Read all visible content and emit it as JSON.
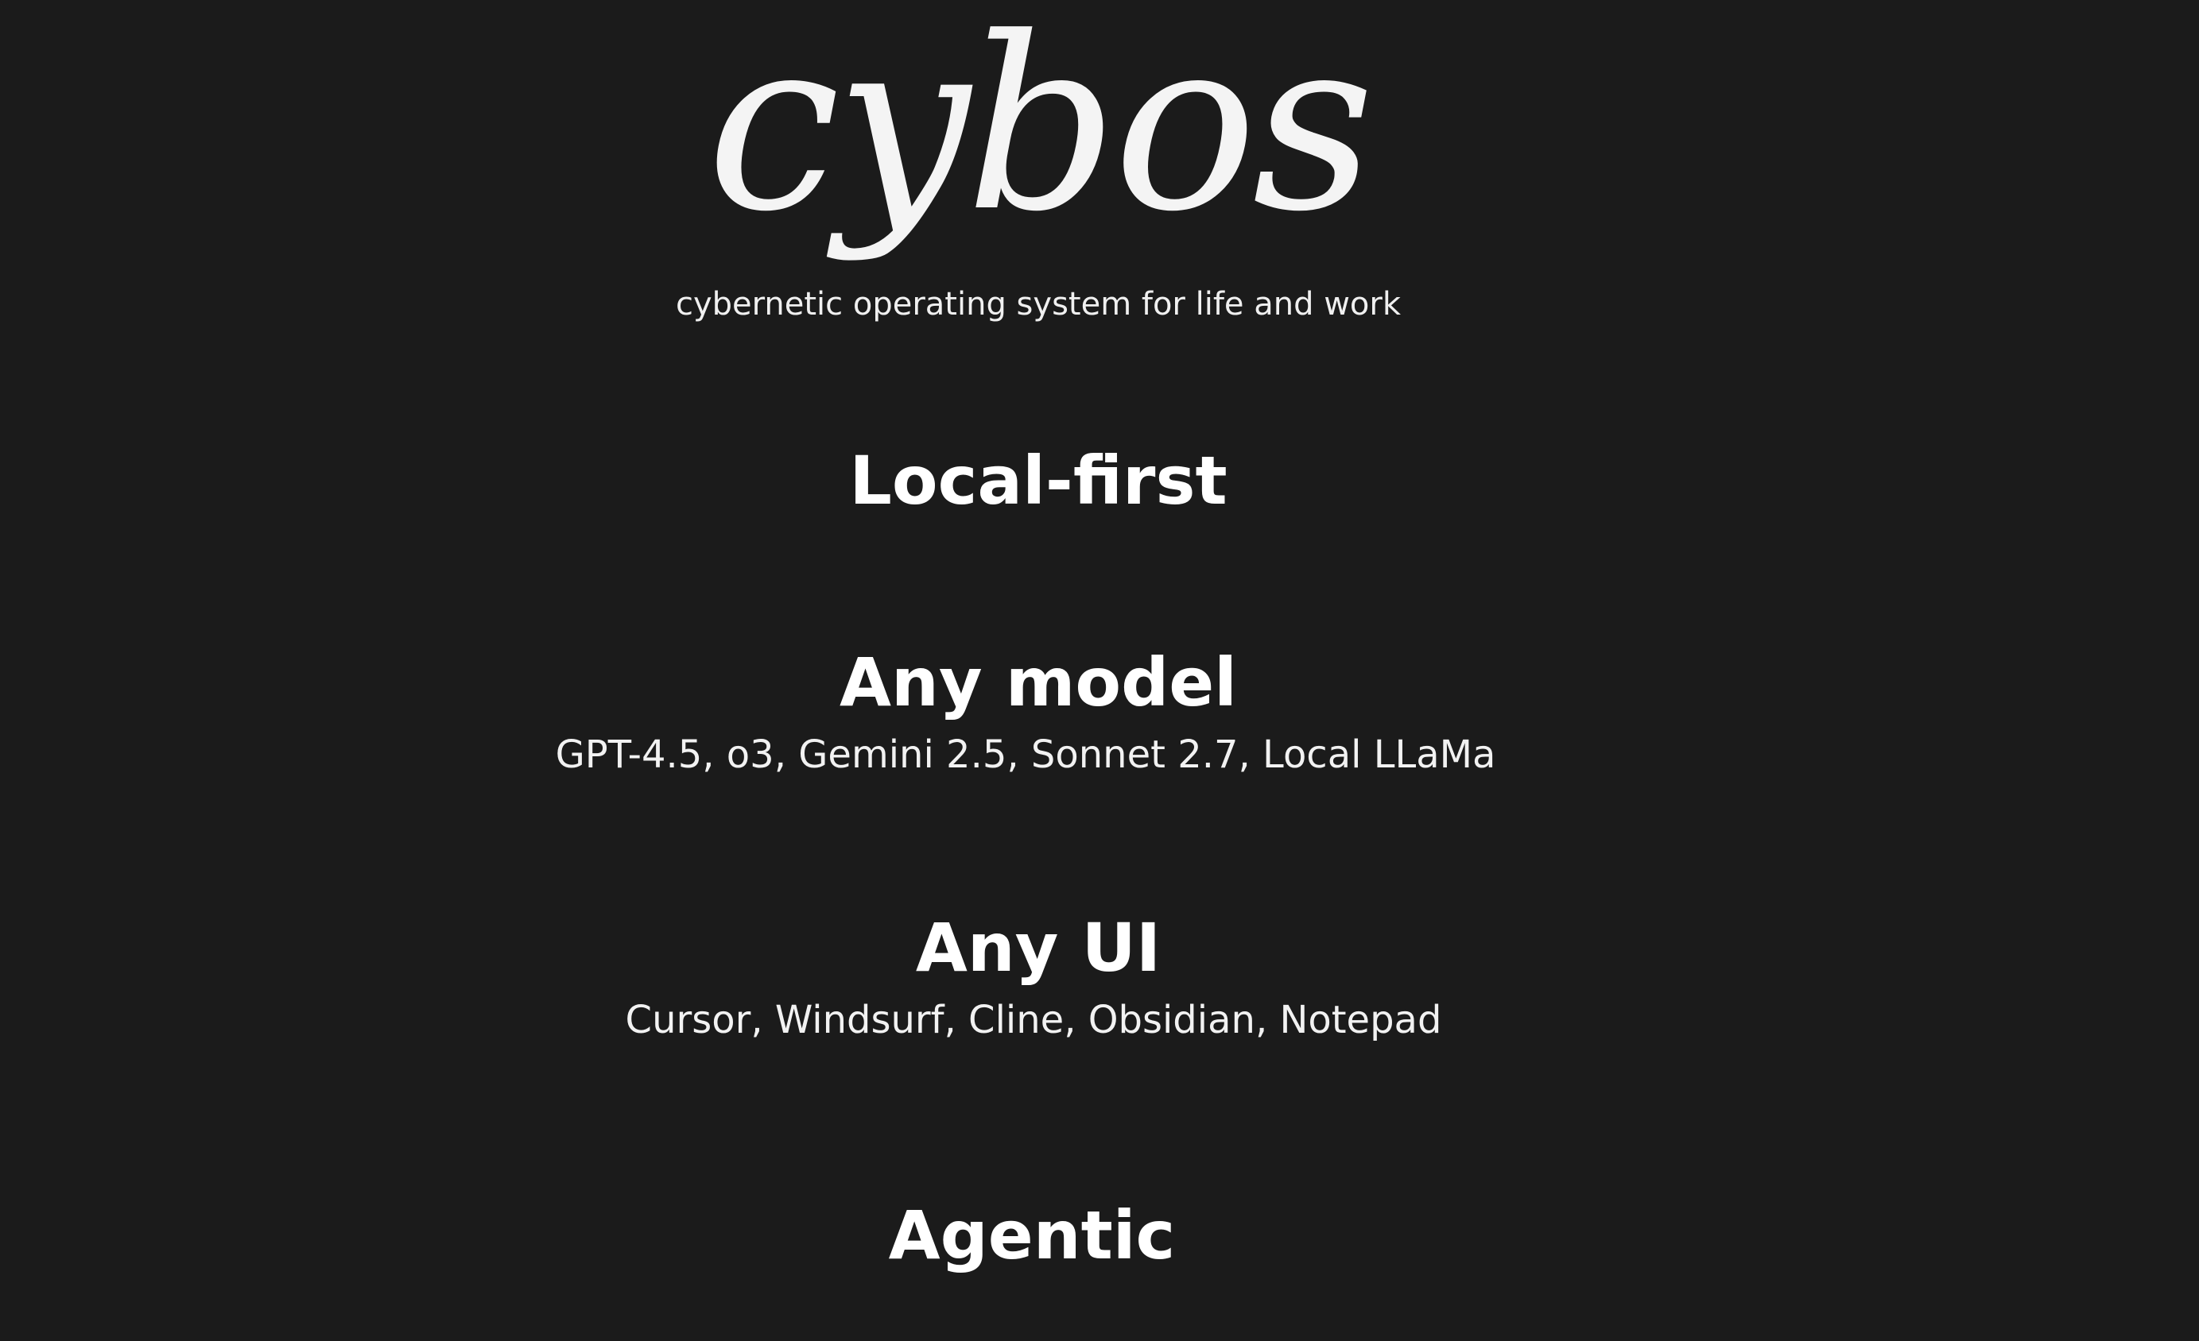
{
  "logo": {
    "text": "cybos"
  },
  "tagline": "cybernetic operating system for life and work",
  "sections": [
    {
      "title": "Local-first",
      "subtitle": ""
    },
    {
      "title": "Any model",
      "subtitle": "GPT-4.5, o3, Gemini 2.5, Sonnet 2.7, Local LLaMa"
    },
    {
      "title": "Any UI",
      "subtitle": "Cursor, Windsurf, Cline, Obsidian, Notepad"
    },
    {
      "title": "Agentic",
      "subtitle": ""
    }
  ],
  "colors": {
    "background": "#1b1b1b",
    "text": "#ffffff"
  }
}
